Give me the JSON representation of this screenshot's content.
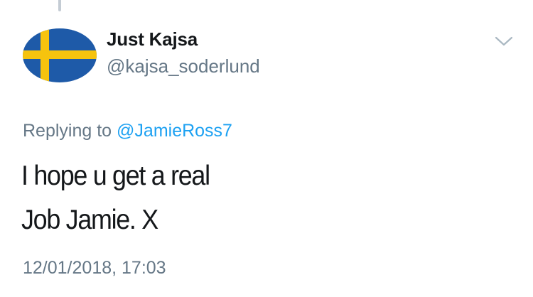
{
  "tweet": {
    "author": {
      "display_name": "Just Kajsa",
      "handle": "@kajsa_soderlund",
      "avatar_icon": "sweden-flag-avatar",
      "flag_colors": {
        "blue": "#1e5aa8",
        "yellow": "#f6c30e"
      }
    },
    "menu_icon": "chevron-down-icon",
    "reply": {
      "prefix": "Replying to",
      "mention": "@JamieRoss7"
    },
    "text_lines": [
      "I hope u get a real",
      "Job Jamie. X"
    ],
    "timestamp": "12/01/2018, 17:03"
  },
  "colors": {
    "text_primary": "#14171a",
    "text_secondary": "#657786",
    "link": "#1da1f2",
    "thread_line": "#c4ccd4"
  }
}
